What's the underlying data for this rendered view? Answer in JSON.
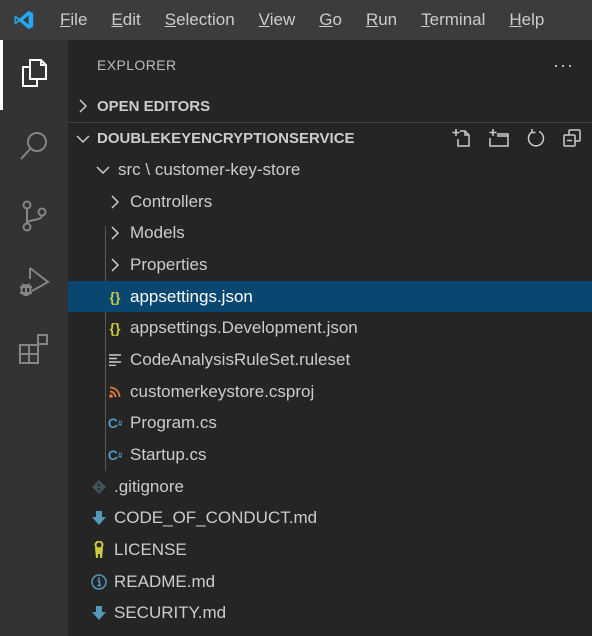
{
  "menu": {
    "items": [
      {
        "label": "File",
        "mnemonic": "F",
        "rest": "ile"
      },
      {
        "label": "Edit",
        "mnemonic": "E",
        "rest": "dit"
      },
      {
        "label": "Selection",
        "mnemonic": "S",
        "rest": "election"
      },
      {
        "label": "View",
        "mnemonic": "V",
        "rest": "iew"
      },
      {
        "label": "Go",
        "mnemonic": "G",
        "rest": "o"
      },
      {
        "label": "Run",
        "mnemonic": "R",
        "rest": "un"
      },
      {
        "label": "Terminal",
        "mnemonic": "T",
        "rest": "erminal"
      },
      {
        "label": "Help",
        "mnemonic": "H",
        "rest": "elp"
      }
    ]
  },
  "activity_bar": {
    "items": [
      "explorer-icon",
      "search-icon",
      "source-control-icon",
      "run-debug-icon",
      "extensions-icon"
    ],
    "active": "explorer-icon"
  },
  "explorer": {
    "title": "EXPLORER",
    "more": "···",
    "open_editors": "OPEN EDITORS",
    "workspace": "DOUBLEKEYENCRYPTIONSERVICE",
    "workspace_actions": [
      "new-file-icon",
      "new-folder-icon",
      "refresh-icon",
      "collapse-all-icon"
    ],
    "folder": "src \\ customer-key-store",
    "subfolders": [
      "Controllers",
      "Models",
      "Properties"
    ],
    "files": [
      {
        "name": "appsettings.json",
        "icon": "json-icon",
        "selected": true
      },
      {
        "name": "appsettings.Development.json",
        "icon": "json-icon",
        "selected": false
      },
      {
        "name": "CodeAnalysisRuleSet.ruleset",
        "icon": "text-lines-icon",
        "selected": false
      },
      {
        "name": "customerkeystore.csproj",
        "icon": "rss-icon",
        "selected": false
      },
      {
        "name": "Program.cs",
        "icon": "csharp-icon",
        "selected": false
      },
      {
        "name": "Startup.cs",
        "icon": "csharp-icon",
        "selected": false
      }
    ],
    "root_files": [
      {
        "name": ".gitignore",
        "icon": "git-icon"
      },
      {
        "name": "CODE_OF_CONDUCT.md",
        "icon": "markdown-download-icon"
      },
      {
        "name": "LICENSE",
        "icon": "license-key-icon"
      },
      {
        "name": "README.md",
        "icon": "info-icon"
      },
      {
        "name": "SECURITY.md",
        "icon": "markdown-download-icon"
      }
    ]
  },
  "colors": {
    "accent": "#007acc",
    "selection": "#094771",
    "json": "#cbcb41",
    "csharp": "#519aba",
    "rss": "#e37933",
    "md": "#519aba"
  }
}
